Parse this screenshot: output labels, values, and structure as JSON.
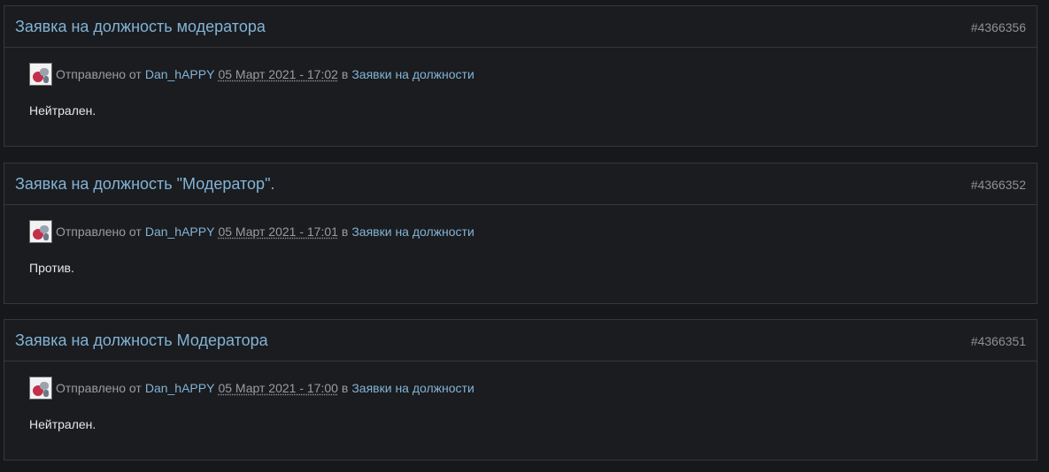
{
  "posts": [
    {
      "title": "Заявка на должность модератора",
      "id": "#4366356",
      "sent_label": "Отправлено от",
      "author": "Dan_hAPPY",
      "date": "05 Март 2021 - 17:02",
      "in_label": "в",
      "forum": "Заявки на должности",
      "body": "Нейтрален."
    },
    {
      "title": "Заявка на должность \"Модератор\".",
      "id": "#4366352",
      "sent_label": "Отправлено от",
      "author": "Dan_hAPPY",
      "date": "05 Март 2021 - 17:01",
      "in_label": "в",
      "forum": "Заявки на должности",
      "body": "Против."
    },
    {
      "title": "Заявка на должность Модератора",
      "id": "#4366351",
      "sent_label": "Отправлено от",
      "author": "Dan_hAPPY",
      "date": "05 Март 2021 - 17:00",
      "in_label": "в",
      "forum": "Заявки на должности",
      "body": "Нейтрален."
    }
  ],
  "colors": {
    "background": "#16181b",
    "panel": "#1a1c1f",
    "border": "#353739",
    "link": "#83b3d6",
    "muted": "#9a9d9f"
  }
}
